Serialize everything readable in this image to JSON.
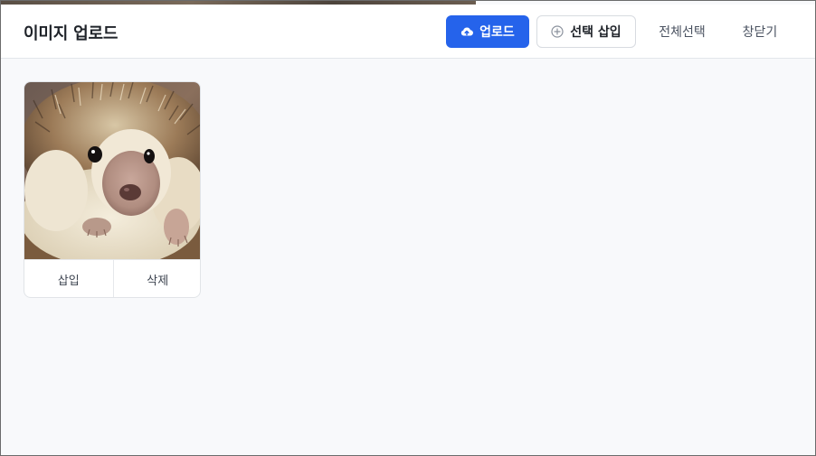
{
  "window": {
    "title": "이미지 업로드"
  },
  "toolbar": {
    "upload_label": "업로드",
    "upload_icon": "cloud-upload-icon",
    "insert_selected_label": "선택 삽입",
    "insert_selected_icon": "plus-circle-icon",
    "select_all_label": "전체선택",
    "close_label": "창닫기"
  },
  "images": [
    {
      "subject": "hedgehog photo",
      "insert_label": "삽입",
      "delete_label": "삭제"
    }
  ],
  "colors": {
    "accent": "#2563eb",
    "background": "#f8f9fb",
    "header": "#ffffff",
    "border": "#e3e6ea"
  }
}
